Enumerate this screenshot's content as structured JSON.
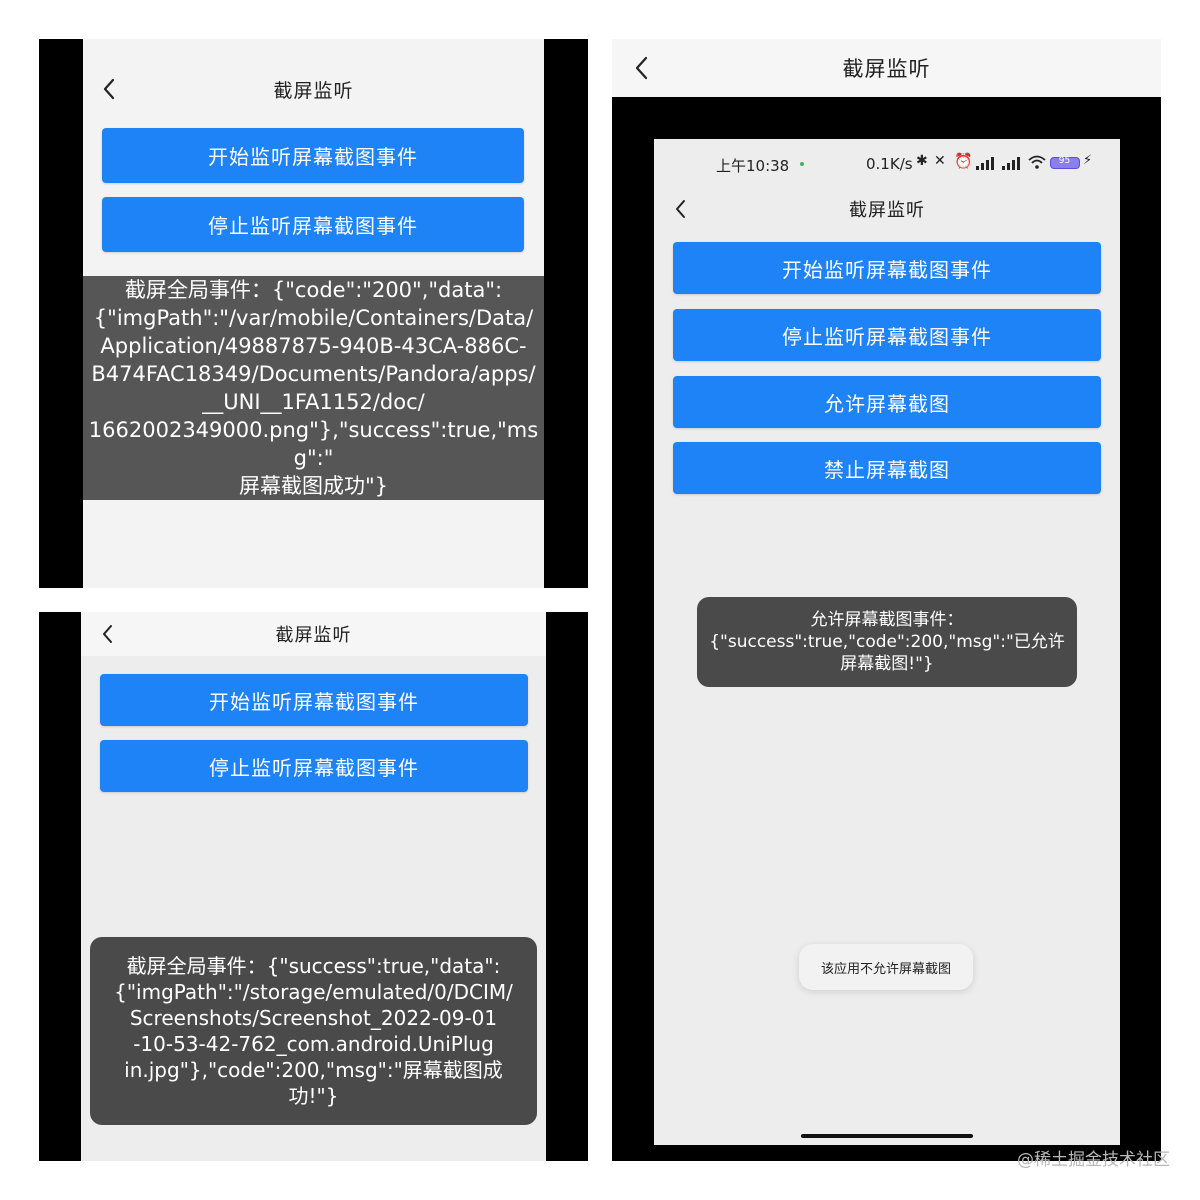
{
  "nav": {
    "title": "截屏监听"
  },
  "buttons": {
    "start": "开始监听屏幕截图事件",
    "stop": "停止监听屏幕截图事件",
    "allow": "允许屏幕截图",
    "forbid": "禁止屏幕截图"
  },
  "panel_ios": {
    "toast": "截屏全局事件：{\"code\":\"200\",\"data\":\n{\"imgPath\":\"/var/mobile/Containers/Data/\nApplication/49887875-940B-43CA-886C-\nB474FAC18349/Documents/Pandora/apps/\n__UNI__1FA1152/doc/\n1662002349000.png\"},\"success\":true,\"msg\":\"\n屏幕截图成功\"}"
  },
  "panel_android": {
    "toast": "截屏全局事件：{\"success\":true,\"data\":\n{\"imgPath\":\"/storage/emulated/0/DCIM/\nScreenshots/Screenshot_2022-09-01\n-10-53-42-762_com.android.UniPlug\nin.jpg\"},\"code\":200,\"msg\":\"屏幕截图成\n功!\"}"
  },
  "panel_right": {
    "status_time": "上午10:38",
    "status_speed": "0.1K/s",
    "battery": "95",
    "toast_allow": "允许屏幕截图事件：\n{\"success\":true,\"code\":200,\"msg\":\"已允许\n屏幕截图!\"}",
    "toast_blocked": "该应用不允许屏幕截图"
  },
  "watermark": "@稀土掘金技术社区",
  "colors": {
    "button": "#1e83f6",
    "toast": "#4a4a4a",
    "screen_bg": "#ededed",
    "navbar_bg": "#f6f6f6"
  }
}
